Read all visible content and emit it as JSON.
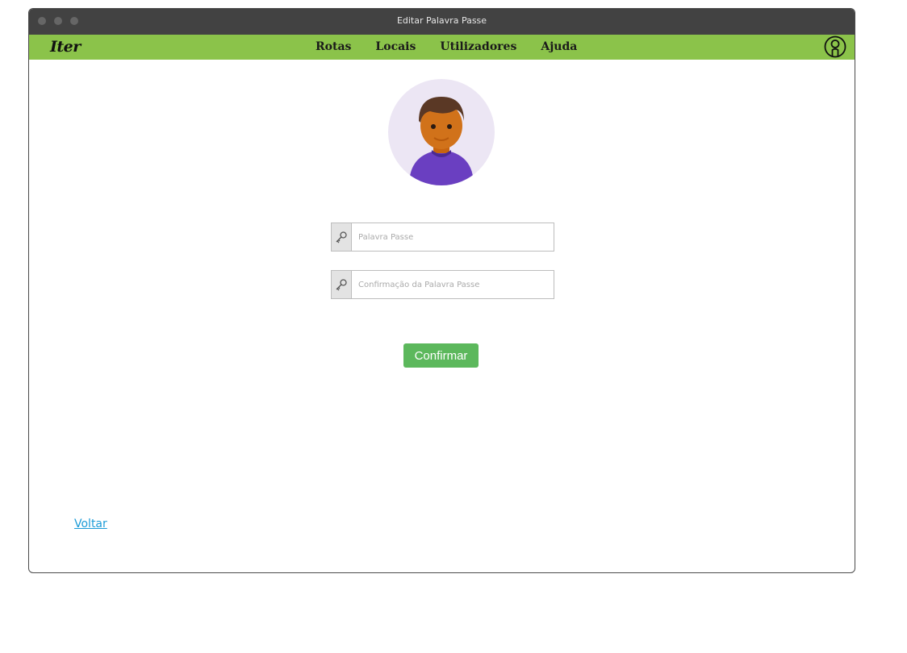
{
  "window": {
    "title": "Editar Palavra Passe"
  },
  "navbar": {
    "logo": "Iter",
    "links": [
      {
        "label": "Rotas"
      },
      {
        "label": "Locais"
      },
      {
        "label": "Utilizadores"
      },
      {
        "label": "Ajuda"
      }
    ],
    "account_icon": "user-circle-icon"
  },
  "profile": {
    "avatar_icon": "person-avatar-icon"
  },
  "form": {
    "password": {
      "placeholder": "Palavra Passe",
      "value": "",
      "icon": "key-icon"
    },
    "password_confirm": {
      "placeholder": "Confirmação da Palavra Passe",
      "value": "",
      "icon": "key-icon"
    },
    "confirm_label": "Confirmar"
  },
  "footer": {
    "back_label": "Voltar"
  },
  "colors": {
    "navbar": "#8bc34a",
    "titlebar": "#424242",
    "confirm_button": "#5cb85c",
    "link": "#1a9bd7"
  }
}
